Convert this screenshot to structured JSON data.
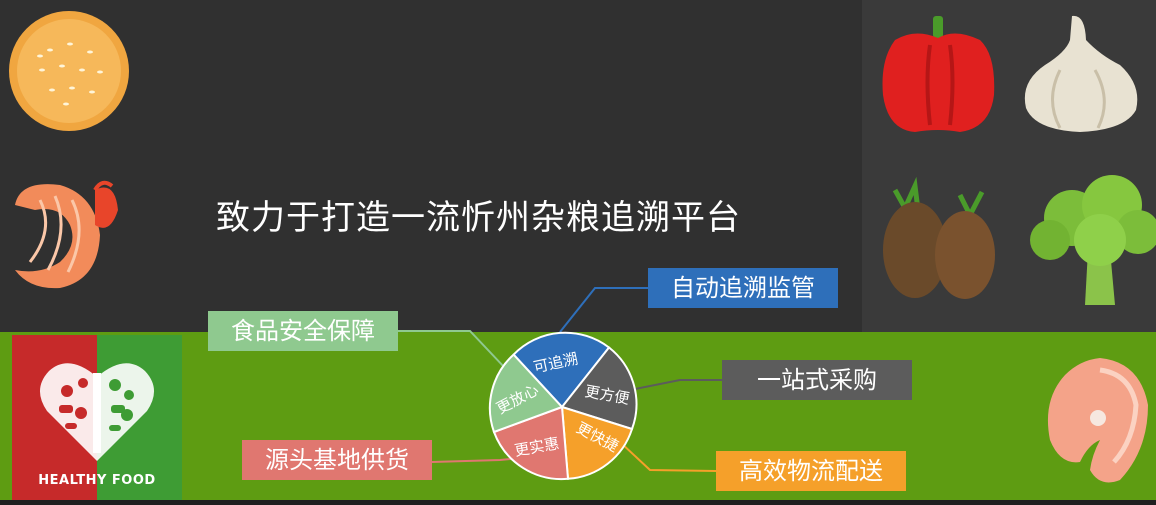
{
  "headline": "致力于打造一流忻州杂粮追溯平台",
  "tags": {
    "auto_trace": "自动追溯监管",
    "food_safety": "食品安全保障",
    "one_stop": "一站式采购",
    "source_base": "源头基地供货",
    "logistics": "高效物流配送"
  },
  "pie": {
    "slices": [
      {
        "label": "可追溯",
        "color": "#2e6fba"
      },
      {
        "label": "更方便",
        "color": "#5c5c5c"
      },
      {
        "label": "更快捷",
        "color": "#f5a02a"
      },
      {
        "label": "更实惠",
        "color": "#e07770"
      },
      {
        "label": "更放心",
        "color": "#8fc98f"
      }
    ]
  },
  "badge": {
    "label": "HEALTHY FOOD"
  },
  "icons": [
    "burger-bun-icon",
    "shrimp-icon",
    "red-pepper-icon",
    "garlic-icon",
    "potato-icon",
    "broccoli-icon",
    "salmon-steak-icon",
    "healthy-food-heart-icon"
  ],
  "colors": {
    "dark_bg": "#303030",
    "green_bg": "#5e9c12"
  }
}
